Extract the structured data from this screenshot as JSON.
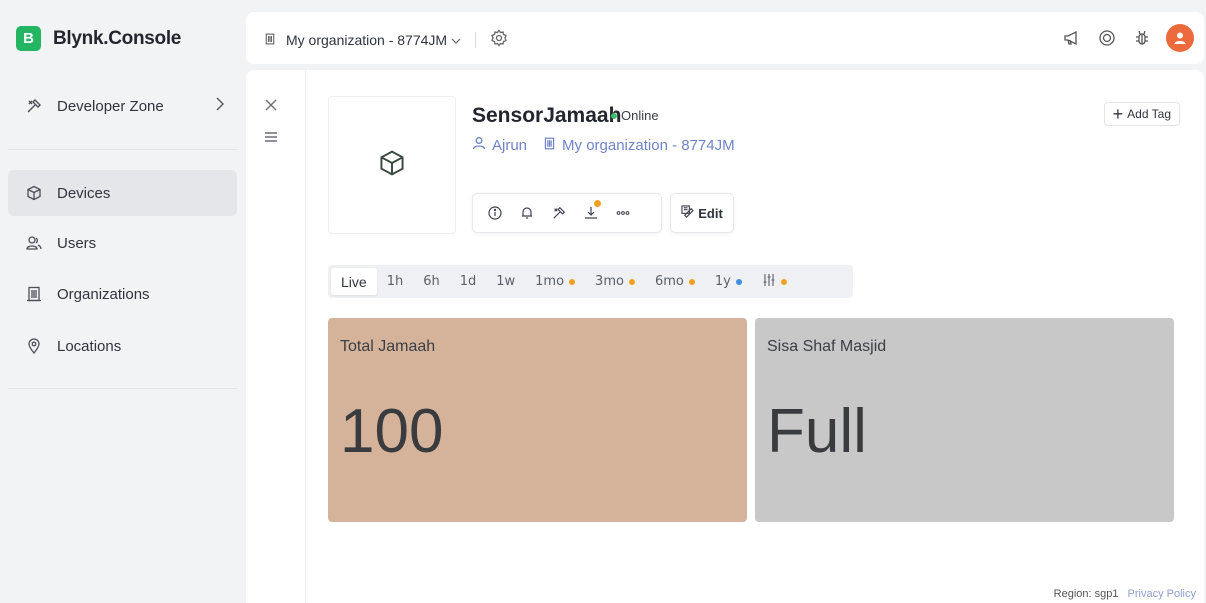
{
  "brand": {
    "logo_letter": "B",
    "name": "Blynk.Console",
    "color": "#24b562"
  },
  "sidebar": {
    "items": [
      {
        "label": "Developer Zone",
        "icon": "tools-icon"
      },
      {
        "label": "Devices",
        "icon": "cube-icon",
        "active": true
      },
      {
        "label": "Users",
        "icon": "users-icon"
      },
      {
        "label": "Organizations",
        "icon": "building-icon"
      },
      {
        "label": "Locations",
        "icon": "location-pin-icon"
      }
    ]
  },
  "topbar": {
    "organization": "My organization - 8774JM",
    "icons": [
      "megaphone-icon",
      "support-icon",
      "bug-icon",
      "avatar"
    ]
  },
  "device": {
    "name": "SensorJamaah",
    "status": "Online",
    "owner": "Ajrun",
    "organization": "My organization - 8774JM",
    "edit_label": "Edit",
    "add_tag_label": "Add Tag",
    "actions": [
      "info-icon",
      "bell-icon",
      "tools-icon",
      "download-icon",
      "more-icon"
    ]
  },
  "time_ranges": [
    {
      "label": "Live",
      "active": true,
      "dot": null
    },
    {
      "label": "1h",
      "dot": null
    },
    {
      "label": "6h",
      "dot": null
    },
    {
      "label": "1d",
      "dot": null
    },
    {
      "label": "1w",
      "dot": null
    },
    {
      "label": "1mo",
      "dot": "#f0a023"
    },
    {
      "label": "3mo",
      "dot": "#f0a023"
    },
    {
      "label": "6mo",
      "dot": "#f0a023"
    },
    {
      "label": "1y",
      "dot": "#3f8ee0"
    },
    {
      "label": "",
      "icon": "sliders-icon",
      "dot": "#f0a023"
    }
  ],
  "widgets": [
    {
      "title": "Total Jamaah",
      "value": "100",
      "color": "#d5b39b"
    },
    {
      "title": "Sisa Shaf Masjid",
      "value": "Full",
      "color": "#c8c8c8"
    }
  ],
  "footer": {
    "region": "Region: sgp1",
    "privacy": "Privacy Policy"
  }
}
